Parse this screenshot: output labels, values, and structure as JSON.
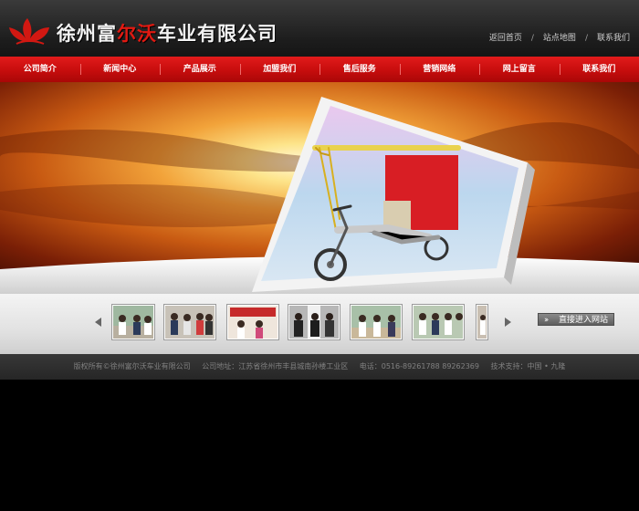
{
  "header": {
    "logo_text_1": "徐州富",
    "logo_text_2": "尔沃",
    "logo_text_3": "车业有限公司",
    "top_links": [
      "返回首页",
      "站点地图",
      "联系我们"
    ],
    "separator": "/"
  },
  "nav": {
    "items": [
      "公司简介",
      "新闻中心",
      "产品展示",
      "加盟我们",
      "售后服务",
      "营销网络",
      "网上留言",
      "联系我们"
    ]
  },
  "gallery": {
    "enter_label": "直接进入网站",
    "enter_icon": "double-chevron-right-icon"
  },
  "footer": {
    "copyright": "版权所有©徐州富尔沃车业有限公司",
    "address": "公司地址：江苏省徐州市丰县城南孙楼工业区",
    "phone": "电话：0516-89261788 89262369",
    "support": "技术支持：中国 • 九隆"
  },
  "colors": {
    "nav_red": "#c60d0d",
    "brand_red": "#e01a12",
    "header_dark": "#1d1d1d"
  }
}
